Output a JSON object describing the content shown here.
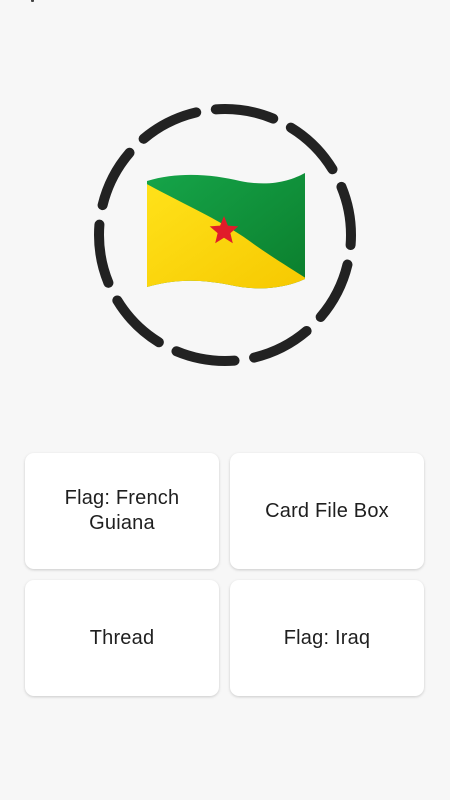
{
  "quiz": {
    "emoji_icon": "flag-french-guiana-icon",
    "colors": {
      "background": "#f7f7f7",
      "ring": "#222222",
      "flag_green": "#0f9a3a",
      "flag_yellow": "#fedb00",
      "flag_star": "#e11c2a"
    },
    "options": [
      {
        "label": "Flag: French Guiana"
      },
      {
        "label": "Card File Box"
      },
      {
        "label": "Thread"
      },
      {
        "label": "Flag: Iraq"
      }
    ]
  }
}
